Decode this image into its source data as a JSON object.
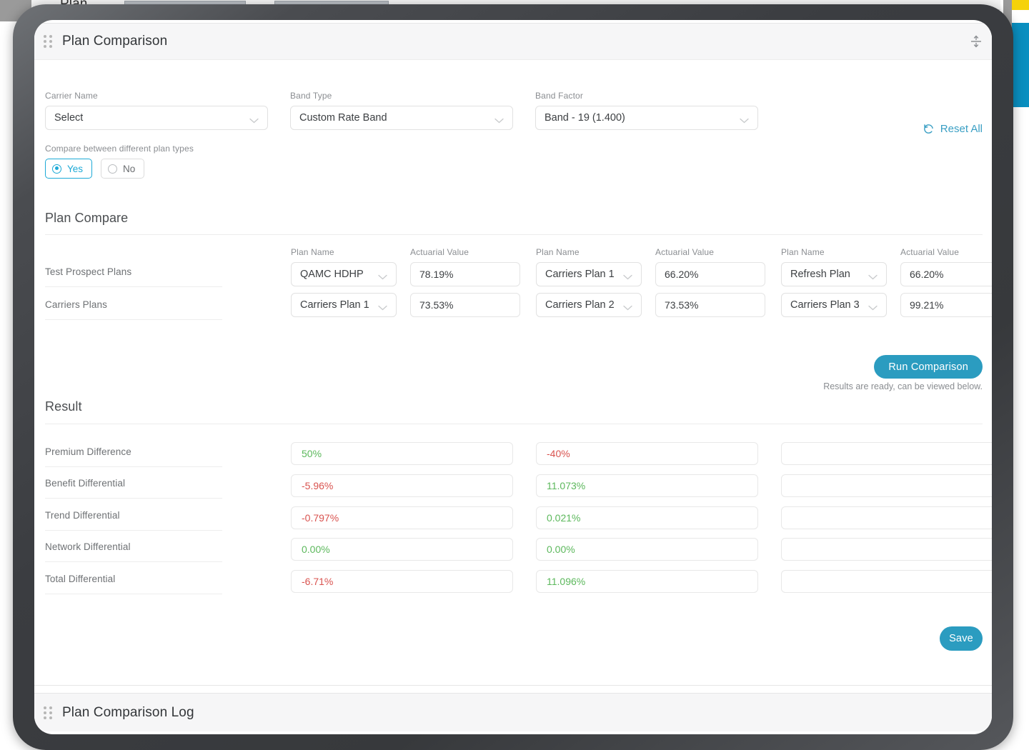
{
  "background": {
    "ghost_title": "Plan"
  },
  "main_card": {
    "title": "Plan Comparison",
    "drag_handle_icon": "drag-dots-icon",
    "collapse_icon": "collapse-vertical-icon"
  },
  "filters": {
    "carrier_name": {
      "label": "Carrier Name",
      "value": "Select"
    },
    "band_type": {
      "label": "Band Type",
      "value": "Custom Rate Band"
    },
    "band_factor": {
      "label": "Band Factor",
      "value": "Band - 19 (1.400)"
    },
    "reset_all": {
      "label": "Reset All",
      "icon": "reset-circular-arrow-icon",
      "color": "#3a9fc4"
    },
    "compare_toggle": {
      "label": "Compare between different plan types",
      "options": [
        "Yes",
        "No"
      ],
      "selected": "Yes",
      "accent": "#1ca9d6"
    }
  },
  "plan_compare": {
    "title": "Plan Compare",
    "row_labels": [
      "Test Prospect Plans",
      "Carriers Plans"
    ],
    "column_headers": {
      "plan_name": "Plan Name",
      "actuarial_value": "Actuarial Value"
    },
    "groups": [
      {
        "rows": [
          {
            "plan_name": "QAMC HDHP",
            "actuarial_value": "78.19%"
          },
          {
            "plan_name": "Carriers Plan 1",
            "actuarial_value": "73.53%"
          }
        ]
      },
      {
        "rows": [
          {
            "plan_name": "Carriers Plan 1",
            "actuarial_value": "66.20%"
          },
          {
            "plan_name": "Carriers Plan 2",
            "actuarial_value": "73.53%"
          }
        ]
      },
      {
        "rows": [
          {
            "plan_name": "Refresh Plan",
            "actuarial_value": "66.20%"
          },
          {
            "plan_name": "Carriers Plan 3",
            "actuarial_value": "99.21%"
          }
        ]
      }
    ],
    "run_button": "Run Comparison",
    "status_note": "Results are ready, can be viewed below."
  },
  "result": {
    "title": "Result",
    "rows": [
      {
        "label": "Premium Difference",
        "values": [
          {
            "text": "50%",
            "tone": "pos"
          },
          {
            "text": "-40%",
            "tone": "neg"
          },
          {
            "text": "",
            "tone": "none"
          }
        ]
      },
      {
        "label": "Benefit Differential",
        "values": [
          {
            "text": "-5.96%",
            "tone": "neg"
          },
          {
            "text": "11.073%",
            "tone": "pos"
          },
          {
            "text": "",
            "tone": "none"
          }
        ]
      },
      {
        "label": "Trend Differential",
        "values": [
          {
            "text": "-0.797%",
            "tone": "neg"
          },
          {
            "text": "0.021%",
            "tone": "pos"
          },
          {
            "text": "",
            "tone": "none"
          }
        ]
      },
      {
        "label": "Network Differential",
        "values": [
          {
            "text": "0.00%",
            "tone": "pos"
          },
          {
            "text": "0.00%",
            "tone": "pos"
          },
          {
            "text": "",
            "tone": "none"
          }
        ]
      },
      {
        "label": "Total Differential",
        "values": [
          {
            "text": "-6.71%",
            "tone": "neg"
          },
          {
            "text": "11.096%",
            "tone": "pos"
          },
          {
            "text": "",
            "tone": "none"
          }
        ]
      }
    ],
    "save_button": "Save"
  },
  "log_card": {
    "title": "Plan Comparison Log",
    "drag_handle_icon": "drag-dots-icon"
  },
  "colors": {
    "primary": "#2b9cc0",
    "accent": "#1ca9d6",
    "link": "#3a9fc4",
    "positive": "#5cb85c",
    "negative": "#d9534f"
  }
}
